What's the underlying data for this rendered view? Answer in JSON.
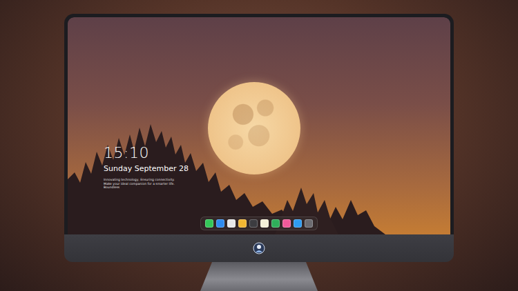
{
  "lock_screen": {
    "time": "15:10",
    "date": "Sunday September 28",
    "tagline": "Innovating technology, Ensuring connectivity. Make your ideal companion for a smarter life. Boundless"
  },
  "dock": {
    "items": [
      {
        "color": "#34c759"
      },
      {
        "color": "#2f8cf0"
      },
      {
        "color": "#e8e8e8"
      },
      {
        "color": "#f2b632"
      },
      {
        "color": "#3c3c40"
      },
      {
        "color": "#f5f0d8"
      },
      {
        "color": "#2fae5a"
      },
      {
        "color": "#f05a9a"
      },
      {
        "color": "#2e9cf0"
      },
      {
        "color": "#6b6b70"
      }
    ]
  }
}
